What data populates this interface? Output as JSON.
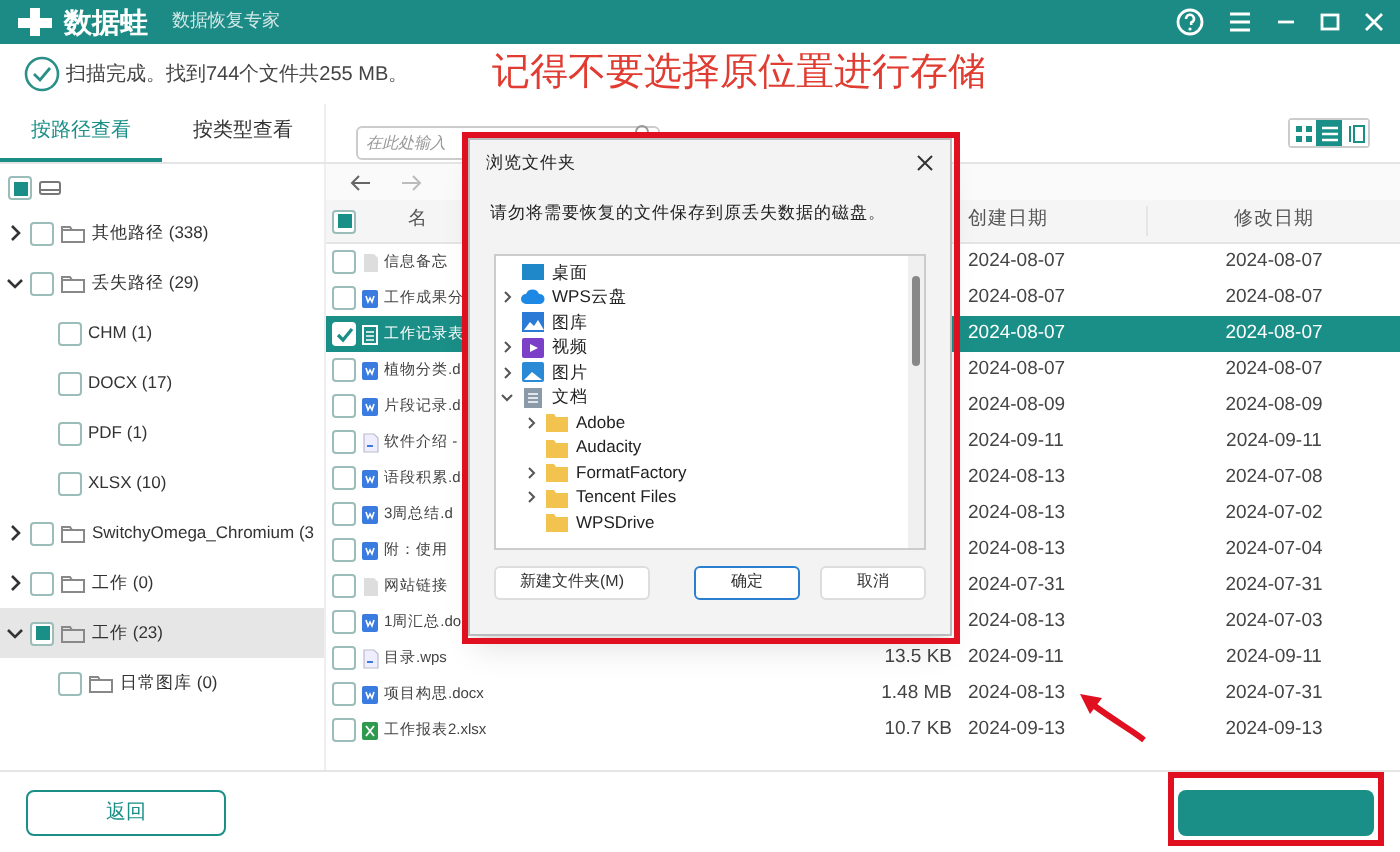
{
  "app": {
    "name": "数据蛙",
    "subtitle": "数据恢复专家"
  },
  "status": {
    "message": "扫描完成。找到744个文件共255 MB。"
  },
  "annotation": {
    "text": "记得不要选择原位置进行存储"
  },
  "view_tabs": [
    {
      "label": "按路径查看",
      "selected": true
    },
    {
      "label": "按类型查看",
      "selected": false
    }
  ],
  "search": {
    "placeholder": "在此处输入"
  },
  "view_modes": [
    {
      "kind": "grid",
      "selected": false
    },
    {
      "kind": "list",
      "selected": true
    },
    {
      "kind": "columns",
      "selected": false
    }
  ],
  "drive": {
    "checked": false,
    "partial": true
  },
  "tree": [
    {
      "label": "其他路径 (338)",
      "kind": "folder",
      "checked": false,
      "partial": false,
      "expanded": false,
      "selected": false
    },
    {
      "label": "丢失路径 (29)",
      "kind": "folder",
      "checked": false,
      "partial": false,
      "expanded": true,
      "selected": false,
      "children": [
        {
          "label": "CHM (1)",
          "kind": "type",
          "checked": false,
          "partial": false,
          "selected": false
        },
        {
          "label": "DOCX (17)",
          "kind": "type",
          "checked": false,
          "partial": false,
          "selected": false
        },
        {
          "label": "PDF (1)",
          "kind": "type",
          "checked": false,
          "partial": false,
          "selected": false
        },
        {
          "label": "XLSX (10)",
          "kind": "type",
          "checked": false,
          "partial": false,
          "selected": false
        }
      ]
    },
    {
      "label": "SwitchyOmega_Chromium (3",
      "kind": "folder",
      "checked": false,
      "partial": false,
      "expanded": false,
      "selected": false
    },
    {
      "label": "工作 (0)",
      "kind": "folder",
      "checked": false,
      "partial": false,
      "expanded": false,
      "selected": false
    },
    {
      "label": "工作 (23)",
      "kind": "folder",
      "checked": false,
      "partial": true,
      "expanded": true,
      "selected": true,
      "children": [
        {
          "label": "日常图库 (0)",
          "kind": "folder",
          "checked": false,
          "partial": false,
          "selected": false
        }
      ]
    }
  ],
  "table": {
    "header_partial": true,
    "columns": [
      "名",
      "创建日期",
      "修改日期"
    ],
    "rows": [
      {
        "name": "信息备忘",
        "kind": "text",
        "checked": false,
        "selected": false,
        "created": "2024-08-07",
        "modified": "2024-08-07"
      },
      {
        "name": "工作成果分",
        "kind": "word",
        "checked": false,
        "selected": false,
        "created": "2024-08-07",
        "modified": "2024-08-07"
      },
      {
        "name": "工作记录表",
        "kind": "sheet",
        "checked": true,
        "selected": true,
        "created": "2024-08-07",
        "modified": "2024-08-07"
      },
      {
        "name": "植物分类.d",
        "kind": "word",
        "checked": false,
        "selected": false,
        "created": "2024-08-07",
        "modified": "2024-08-07"
      },
      {
        "name": "片段记录.d",
        "kind": "word",
        "checked": false,
        "selected": false,
        "created": "2024-08-09",
        "modified": "2024-08-09"
      },
      {
        "name": "软件介绍 -",
        "kind": "wps",
        "checked": false,
        "selected": false,
        "created": "2024-09-11",
        "modified": "2024-09-11"
      },
      {
        "name": "语段积累.d",
        "kind": "word",
        "checked": false,
        "selected": false,
        "created": "2024-08-13",
        "modified": "2024-07-08"
      },
      {
        "name": "3周总结.d",
        "kind": "word",
        "checked": false,
        "selected": false,
        "created": "2024-08-13",
        "modified": "2024-07-02"
      },
      {
        "name": "附：使用",
        "kind": "word",
        "checked": false,
        "selected": false,
        "created": "2024-08-13",
        "modified": "2024-07-04"
      },
      {
        "name": "网站链接",
        "kind": "text",
        "checked": false,
        "selected": false,
        "created": "2024-07-31",
        "modified": "2024-07-31"
      },
      {
        "name": "1周汇总.do",
        "kind": "word",
        "checked": false,
        "selected": false,
        "created": "2024-08-13",
        "modified": "2024-07-03"
      },
      {
        "name": "目录.wps",
        "kind": "wps",
        "checked": false,
        "selected": false,
        "size": "13.5 KB",
        "created": "2024-09-11",
        "modified": "2024-09-11"
      },
      {
        "name": "项目构思.docx",
        "kind": "word",
        "checked": false,
        "selected": false,
        "size": "1.48 MB",
        "created": "2024-08-13",
        "modified": "2024-07-31"
      },
      {
        "name": "工作报表2.xlsx",
        "kind": "excel",
        "checked": false,
        "selected": false,
        "size": "10.7 KB",
        "created": "2024-09-13",
        "modified": "2024-09-13"
      }
    ]
  },
  "back_button": {
    "label": "返回"
  },
  "dialog": {
    "title": "浏览文件夹",
    "message": "请勿将需要恢复的文件保存到原丢失数据的磁盘。",
    "tree": [
      {
        "label": "桌面",
        "kind": "desktop"
      },
      {
        "label": "WPS云盘",
        "kind": "cloud",
        "expanded": false
      },
      {
        "label": "图库",
        "kind": "gallery"
      },
      {
        "label": "视频",
        "kind": "video",
        "expanded": false
      },
      {
        "label": "图片",
        "kind": "picture",
        "expanded": false
      },
      {
        "label": "文档",
        "kind": "document",
        "expanded": true,
        "children": [
          {
            "label": "Adobe",
            "kind": "folder",
            "expanded": false
          },
          {
            "label": "Audacity",
            "kind": "folder"
          },
          {
            "label": "FormatFactory",
            "kind": "folder",
            "expanded": false
          },
          {
            "label": "Tencent Files",
            "kind": "folder",
            "expanded": false
          },
          {
            "label": "WPSDrive",
            "kind": "folder"
          }
        ]
      }
    ],
    "buttons": [
      {
        "label": "新建文件夹(M)",
        "default": false
      },
      {
        "label": "确定",
        "default": true
      },
      {
        "label": "取消",
        "default": false
      }
    ]
  }
}
